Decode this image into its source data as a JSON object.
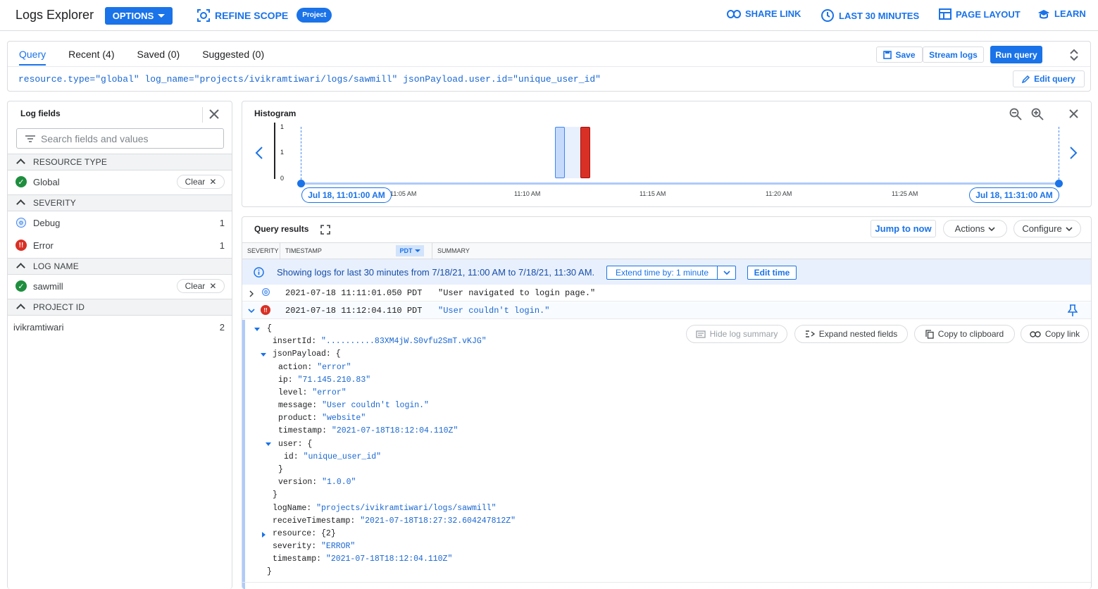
{
  "topbar": {
    "title": "Logs Explorer",
    "options_label": "OPTIONS",
    "refine_label": "REFINE SCOPE",
    "project_badge": "Project",
    "share_link": "SHARE LINK",
    "last_30": "LAST 30 MINUTES",
    "page_layout": "PAGE LAYOUT",
    "learn": "LEARN"
  },
  "query": {
    "tabs": [
      "Query",
      "Recent (4)",
      "Saved (0)",
      "Suggested (0)"
    ],
    "save_label": "Save",
    "stream_label": "Stream logs",
    "run_label": "Run query",
    "edit_label": "Edit query",
    "text": "resource.type=\"global\" log_name=\"projects/ivikramtiwari/logs/sawmill\" jsonPayload.user.id=\"unique_user_id\""
  },
  "fields": {
    "title": "Log fields",
    "search_placeholder": "Search fields and values",
    "clear_label": "Clear",
    "sections": {
      "resource_type": "RESOURCE TYPE",
      "severity": "SEVERITY",
      "log_name": "LOG NAME",
      "project_id": "PROJECT ID"
    },
    "global": "Global",
    "debug": "Debug",
    "debug_count": "1",
    "error": "Error",
    "error_count": "1",
    "sawmill": "sawmill",
    "project": "ivikramtiwari",
    "project_count": "2"
  },
  "histogram": {
    "title": "Histogram",
    "y_ticks": [
      "1",
      "1",
      "0"
    ],
    "x_ticks": [
      "11:05 AM",
      "11:10 AM",
      "11:15 AM",
      "11:20 AM",
      "11:25 AM"
    ],
    "start_label": "Jul 18, 11:01:00 AM",
    "end_label": "Jul 18, 11:31:00 AM",
    "colors": {
      "debug": "#c6dafc",
      "error": "#d93025",
      "axis": "#1a73e8"
    }
  },
  "results": {
    "title": "Query results",
    "jump_label": "Jump to now",
    "actions_label": "Actions",
    "configure_label": "Configure",
    "col_severity": "SEVERITY",
    "col_timestamp": "TIMESTAMP",
    "col_tz": "PDT",
    "col_summary": "SUMMARY",
    "info_text": "Showing logs for last 30 minutes from 7/18/21, 11:00 AM to 7/18/21, 11:30 AM.",
    "extend_label": "Extend time by: 1 minute",
    "edit_time_label": "Edit time",
    "rows": [
      {
        "timestamp": "2021-07-18 11:11:01.050 PDT",
        "summary": "\"User navigated to login page.\""
      },
      {
        "timestamp": "2021-07-18 11:12:04.110 PDT",
        "summary": "\"User couldn't login.\""
      }
    ],
    "hide_summary": "Hide log summary",
    "expand_nested": "Expand nested fields",
    "copy_clipboard": "Copy to clipboard",
    "copy_link": "Copy link"
  },
  "json_lines": [
    {
      "k": "{",
      "v": ""
    },
    {
      "k": "insertId: ",
      "v": "\"..........83XM4jW.S0vfu2SmT.vKJG\""
    },
    {
      "k": "jsonPayload: {",
      "v": ""
    },
    {
      "k": "action: ",
      "v": "\"error\""
    },
    {
      "k": "ip: ",
      "v": "\"71.145.210.83\""
    },
    {
      "k": "level: ",
      "v": "\"error\""
    },
    {
      "k": "message: ",
      "v": "\"User couldn't login.\""
    },
    {
      "k": "product: ",
      "v": "\"website\""
    },
    {
      "k": "timestamp: ",
      "v": "\"2021-07-18T18:12:04.110Z\""
    },
    {
      "k": "user: {",
      "v": ""
    },
    {
      "k": "id: ",
      "v": "\"unique_user_id\""
    },
    {
      "k": "}",
      "v": ""
    },
    {
      "k": "version: ",
      "v": "\"1.0.0\""
    },
    {
      "k": "}",
      "v": ""
    },
    {
      "k": "logName: ",
      "v": "\"projects/ivikramtiwari/logs/sawmill\""
    },
    {
      "k": "receiveTimestamp: ",
      "v": "\"2021-07-18T18:27:32.604247812Z\""
    },
    {
      "k": "resource: {2}",
      "v": ""
    },
    {
      "k": "severity: ",
      "v": "\"ERROR\""
    },
    {
      "k": "timestamp: ",
      "v": "\"2021-07-18T18:12:04.110Z\""
    },
    {
      "k": "}",
      "v": ""
    }
  ]
}
